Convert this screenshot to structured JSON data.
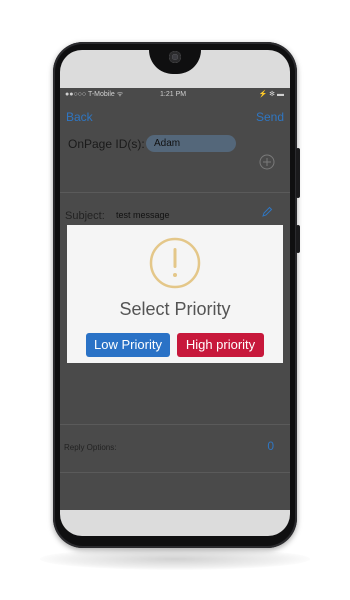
{
  "status_bar": {
    "carrier": "●●○○○ T-Mobile ᯤ",
    "time": "1:21 PM",
    "right": "⚡ ✻ ▬"
  },
  "nav": {
    "back": "Back",
    "send": "Send"
  },
  "form": {
    "onpage_label": "OnPage ID(s):",
    "recipient": "Adam",
    "subject_label": "Subject:",
    "subject_value": "test message",
    "reply_label": "Reply Options:",
    "reply_count": "0"
  },
  "dialog": {
    "icon": "exclamation-circle-icon",
    "title": "Select Priority",
    "low_label": "Low Priority",
    "high_label": "High priority"
  },
  "colors": {
    "link": "#2f76c2",
    "low": "#2a72c6",
    "high": "#c7183b",
    "warn": "#e4c789"
  }
}
